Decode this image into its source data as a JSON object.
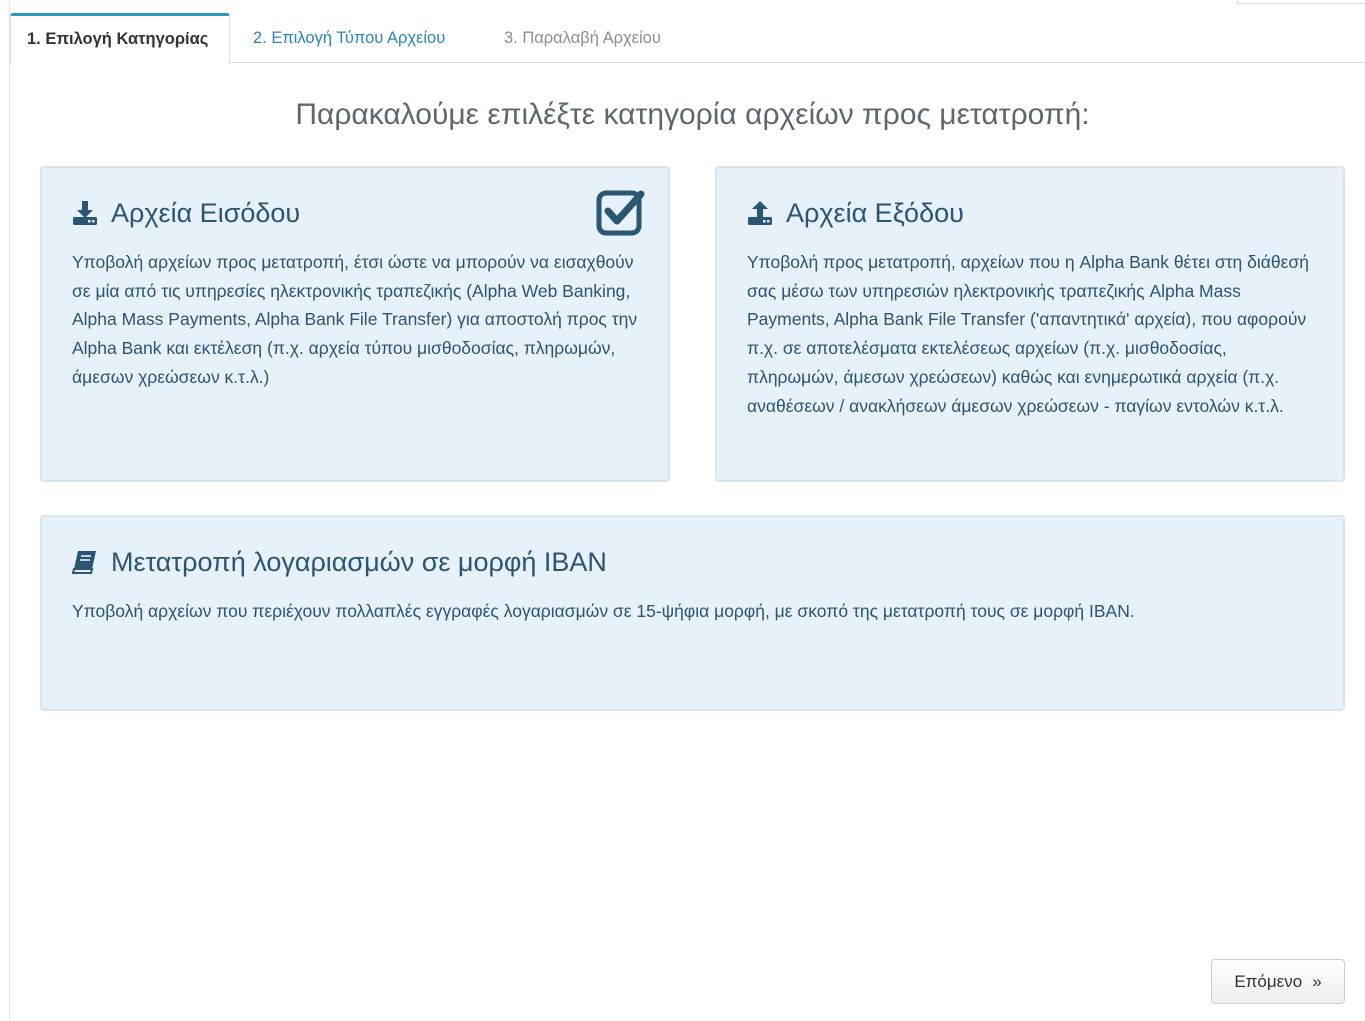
{
  "tabs": [
    {
      "label": "1. Επιλογή Κατηγορίας",
      "state": "active"
    },
    {
      "label": "2. Επιλογή Τύπου Αρχείου",
      "state": "link"
    },
    {
      "label": "3. Παραλαβή Αρχείου",
      "state": "disabled"
    }
  ],
  "heading": "Παρακαλούμε επιλέξτε κατηγορία αρχείων προς μετατροπή:",
  "cards": {
    "input": {
      "title": "Αρχεία Εισόδου",
      "description": "Υποβολή αρχείων προς μετατροπή, έτσι ώστε να μπορούν να εισαχθούν σε μία από τις υπηρεσίες ηλεκτρονικής τραπεζικής (Alpha Web Banking, Alpha Mass Payments, Alpha Bank File Transfer) για αποστολή προς την Alpha Bank και εκτέλεση (π.χ. αρχεία τύπου μισθοδοσίας, πληρωμών, άμεσων χρεώσεων κ.τ.λ.)",
      "icon": "download-icon",
      "selected": true
    },
    "output": {
      "title": "Αρχεία Εξόδου",
      "description": "Υποβολή προς μετατροπή, αρχείων που η Alpha Bank θέτει στη διάθεσή σας μέσω των υπηρεσιών ηλεκτρονικής τραπεζικής Alpha Mass Payments, Alpha Bank File Transfer ('απαντητικά' αρχεία), που αφορούν π.χ. σε αποτελέσματα εκτελέσεως αρχείων (π.χ. μισθοδοσίας, πληρωμών, άμεσων χρεώσεων) καθώς και ενημερωτικά αρχεία (π.χ. αναθέσεων / ανακλήσεων άμεσων χρεώσεων - παγίων εντολών κ.τ.λ.",
      "icon": "upload-icon",
      "selected": false
    },
    "iban": {
      "title": "Μετατροπή λογαριασμών σε μορφή IBAN",
      "description": "Υποβολή αρχείων που περιέχουν πολλαπλές εγγραφές λογαριασμών σε 15-ψήφια μορφή, με σκοπό της μετατροπή τους σε μορφή IBAN.",
      "icon": "book-icon",
      "selected": false
    }
  },
  "next_button": {
    "label": "Επόμενο",
    "arrow": "»"
  },
  "colors": {
    "accent": "#2a9bbd",
    "card_bg": "#e6f1f9",
    "card_border": "#d6e5ef",
    "card_text": "#2b5673"
  }
}
